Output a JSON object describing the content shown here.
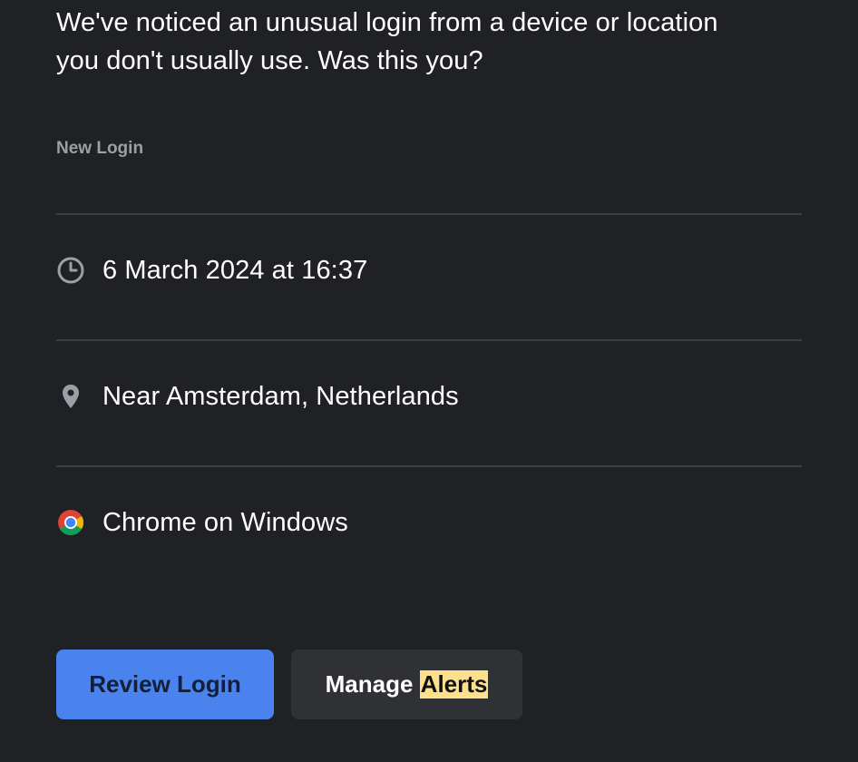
{
  "intro": {
    "line1": "We've noticed an unusual login from a device or location",
    "line2": "you don't usually use. Was this you?"
  },
  "section_label": "New Login",
  "details": [
    {
      "icon": "clock-icon",
      "text": "6 March 2024 at 16:37"
    },
    {
      "icon": "location-pin-icon",
      "text": "Near Amsterdam, Netherlands"
    },
    {
      "icon": "chrome-icon",
      "text": "Chrome on Windows"
    }
  ],
  "buttons": {
    "review_label": "Review Login",
    "manage_label_prefix": "Manage",
    "manage_label_highlight": "Alerts"
  },
  "colors": {
    "background": "#202124",
    "primary_button": "#4a82ee",
    "secondary_button": "#303134",
    "highlight": "#fce08c"
  }
}
